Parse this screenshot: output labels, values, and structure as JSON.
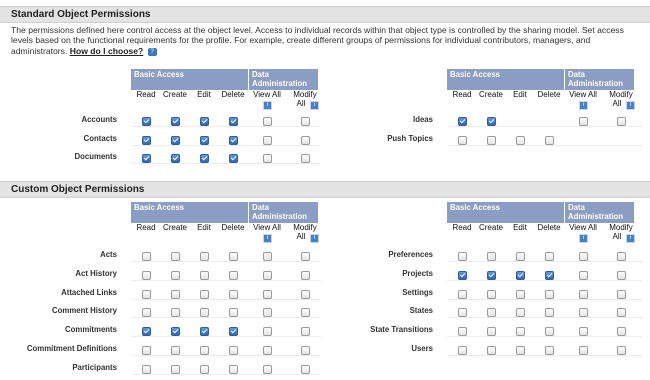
{
  "standard": {
    "title": "Standard Object Permissions",
    "description": "The permissions defined here control access at the object level. Access to individual records within that object type is controlled by the sharing model. Set access levels based on the functional requirements for the profile. For example, create different groups of permissions for individual contributors, managers, and administrators.",
    "help_link": "How do I choose?",
    "left": {
      "rows": [
        {
          "label": "Accounts",
          "checks": [
            true,
            true,
            true,
            true,
            false,
            false
          ]
        },
        {
          "label": "Contacts",
          "checks": [
            true,
            true,
            true,
            true,
            false,
            false
          ]
        },
        {
          "label": "Documents",
          "checks": [
            true,
            true,
            true,
            true,
            false,
            false
          ]
        }
      ]
    },
    "right": {
      "rows": [
        {
          "label": "Ideas",
          "checks": [
            true,
            true,
            null,
            null,
            false,
            false
          ]
        },
        {
          "label": "Push Topics",
          "checks": [
            false,
            false,
            false,
            false,
            null,
            null
          ]
        }
      ]
    }
  },
  "custom": {
    "title": "Custom Object Permissions",
    "left": {
      "rows": [
        {
          "label": "Acts",
          "checks": [
            false,
            false,
            false,
            false,
            false,
            false
          ]
        },
        {
          "label": "Act History",
          "checks": [
            false,
            false,
            false,
            false,
            false,
            false
          ]
        },
        {
          "label": "Attached Links",
          "checks": [
            false,
            false,
            false,
            false,
            false,
            false
          ]
        },
        {
          "label": "Comment History",
          "checks": [
            false,
            false,
            false,
            false,
            false,
            false
          ]
        },
        {
          "label": "Commitments",
          "checks": [
            true,
            true,
            true,
            true,
            false,
            false
          ]
        },
        {
          "label": "Commitment Definitions",
          "checks": [
            false,
            false,
            false,
            false,
            false,
            false
          ]
        },
        {
          "label": "Participants",
          "checks": [
            false,
            false,
            false,
            false,
            false,
            false
          ]
        }
      ]
    },
    "right": {
      "rows": [
        {
          "label": "Preferences",
          "checks": [
            false,
            false,
            false,
            false,
            false,
            false
          ]
        },
        {
          "label": "Projects",
          "checks": [
            true,
            true,
            true,
            true,
            false,
            false
          ]
        },
        {
          "label": "Settings",
          "checks": [
            false,
            false,
            false,
            false,
            false,
            false
          ]
        },
        {
          "label": "States",
          "checks": [
            false,
            false,
            false,
            false,
            false,
            false
          ]
        },
        {
          "label": "State Transitions",
          "checks": [
            false,
            false,
            false,
            false,
            false,
            false
          ]
        },
        {
          "label": "Users",
          "checks": [
            false,
            false,
            false,
            false,
            false,
            false
          ]
        }
      ]
    }
  },
  "headers": {
    "basic_access": "Basic Access",
    "data_admin_line1": "Data",
    "data_admin_line2": "Administration",
    "read": "Read",
    "create": "Create",
    "edit": "Edit",
    "delete": "Delete",
    "view_all": "View All",
    "modify_line1": "Modify",
    "modify_line2": "All",
    "info_glyph": "i",
    "help_glyph": "?"
  },
  "icons": {
    "info": "info-icon",
    "help": "help-icon",
    "checkbox_checked_color": "#2f66b0",
    "header_group_color": "#8b9dc3"
  }
}
